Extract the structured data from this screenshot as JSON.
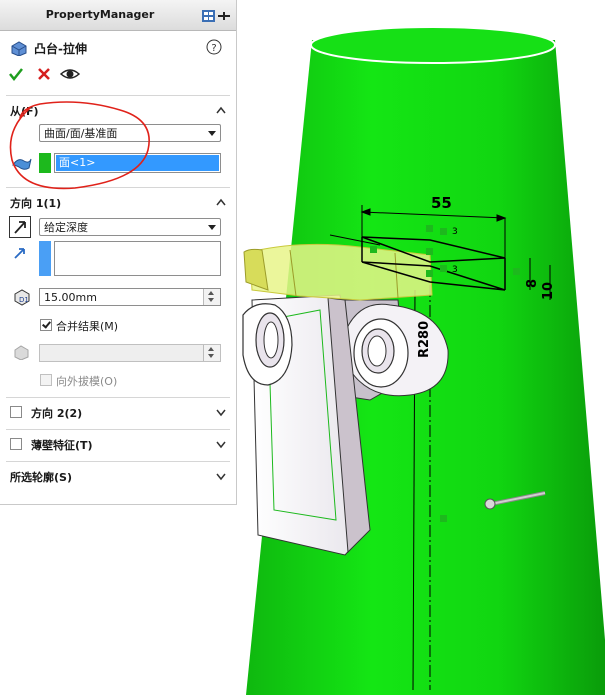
{
  "panel": {
    "header_title": "PropertyManager",
    "feature_title": "凸台-拉伸",
    "sections": {
      "from": {
        "label": "从(F)",
        "start_condition": "曲面/面/基准面",
        "selected_face": "面<1>"
      },
      "direction1": {
        "label": "方向 1(1)",
        "end_condition": "给定深度",
        "depth": "15.00mm",
        "merge_result_label": "合并结果(M)",
        "merge_result_checked": true,
        "draft_outward_label": "向外拔模(O)",
        "draft_outward_checked": false
      },
      "direction2": {
        "label": "方向 2(2)",
        "checked": false
      },
      "thin_feature": {
        "label": "薄壁特征(T)",
        "checked": false
      },
      "selected_contours": {
        "label": "所选轮廓(S)"
      }
    }
  },
  "sketch": {
    "dim_width": "55",
    "dim_radius": "R280",
    "dim_height_a": "8",
    "dim_height_b": "10",
    "relation_mark": "3"
  },
  "colors": {
    "body_green": "#10dd10",
    "selection_green": "#1db91d",
    "highlight_yellow": "#e8f58a",
    "annotation_red": "#e0221a",
    "select_blue": "#3399ff"
  },
  "icons": [
    "boss-extrude-icon",
    "help-icon",
    "ok-checkmark-icon",
    "cancel-x-icon",
    "preview-eye-icon",
    "pin-icon",
    "chevron-up-icon",
    "chevron-down-icon",
    "face-selection-icon",
    "reverse-direction-icon",
    "direction-arrow-icon",
    "depth-icon",
    "draft-icon"
  ]
}
